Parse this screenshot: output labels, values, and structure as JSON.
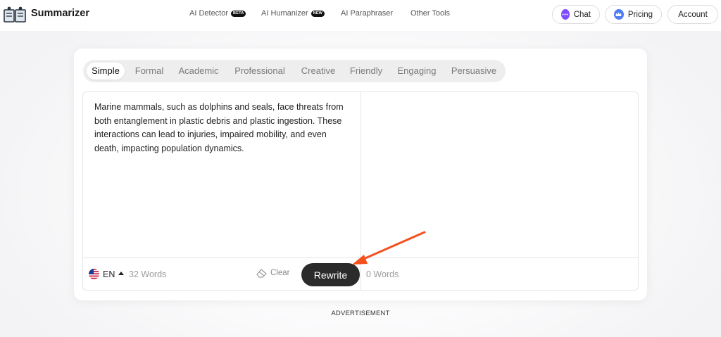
{
  "header": {
    "brand": "Summarizer",
    "nav": [
      {
        "label": "AI Detector",
        "badge": "BETA"
      },
      {
        "label": "AI Humanizer",
        "badge": "NEW"
      },
      {
        "label": "AI Paraphraser",
        "badge": ""
      },
      {
        "label": "Other Tools",
        "badge": ""
      }
    ],
    "chat_label": "Chat",
    "pricing_label": "Pricing",
    "account_label": "Account"
  },
  "tabs": [
    "Simple",
    "Formal",
    "Academic",
    "Professional",
    "Creative",
    "Friendly",
    "Engaging",
    "Persuasive"
  ],
  "active_tab": "Simple",
  "editor": {
    "input_text": "Marine mammals, such as dolphins and seals, face threats from both entanglement in plastic debris and plastic ingestion. These interactions can lead to injuries, impaired mobility, and even death, impacting population dynamics.",
    "language": "EN",
    "input_word_count": "32 Words",
    "clear_label": "Clear",
    "rewrite_label": "Rewrite",
    "output_word_count": "0 Words"
  },
  "advertisement_label": "ADVERTISEMENT",
  "colors": {
    "arrow": "#f4511e",
    "rewrite_bg": "#2b2b2b",
    "chat_icon": "#7c4dff",
    "pricing_icon": "#4f7cf7"
  }
}
